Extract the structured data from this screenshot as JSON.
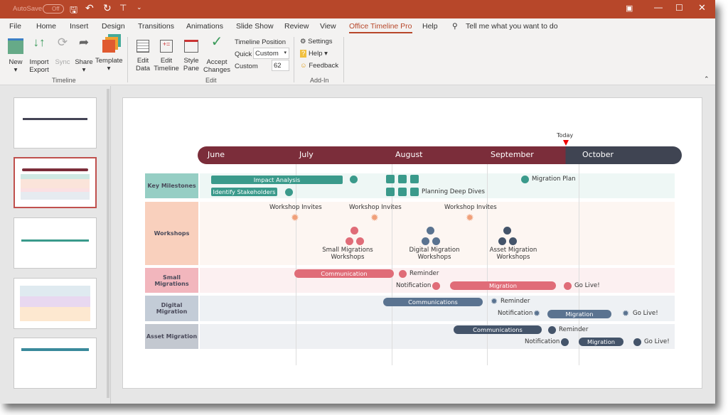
{
  "titlebar": {
    "autosave": "AutoSave",
    "autosave_state": "Off",
    "accent": "#b7472a"
  },
  "tabs": [
    "File",
    "Home",
    "Insert",
    "Design",
    "Transitions",
    "Animations",
    "Slide Show",
    "Review",
    "View",
    "Office Timeline Pro",
    "Help"
  ],
  "tell_me": "Tell me what you want to do",
  "ribbon": {
    "timeline_group": {
      "label": "Timeline",
      "buttons": [
        "New",
        "Import Export",
        "Sync",
        "Share",
        "Template"
      ]
    },
    "edit_group": {
      "label": "Edit",
      "buttons": [
        "Edit Data",
        "Edit Timeline",
        "Style Pane",
        "Accept Changes"
      ],
      "position_title": "Timeline Position",
      "quick_label": "Quick",
      "quick_value": "Custom",
      "custom_label": "Custom",
      "custom_value": "62"
    },
    "addin_group": {
      "label": "Add-In",
      "items": [
        "Settings",
        "Help",
        "Feedback"
      ]
    }
  },
  "slide": {
    "today": "Today",
    "months": [
      "June",
      "July",
      "August",
      "September",
      "October"
    ],
    "rows": [
      "Key Milestones",
      "Workshops",
      "Small Migrations",
      "Digital Migration",
      "Asset Migration"
    ],
    "key": {
      "impact": "Impact Analysis",
      "identify": "Identify Stakeholders",
      "plan": "Migration Plan",
      "deep": "Planning Deep Dives"
    },
    "workshops": {
      "invites": "Workshop Invites",
      "small": "Small Migrations Workshops",
      "digital": "Digital Migration Workshops",
      "asset": "Asset Migration Workshops"
    },
    "small": {
      "comm": "Communication",
      "reminder": "Reminder",
      "notification": "Notification",
      "migration": "Migration",
      "golive": "Go Live!"
    },
    "digital": {
      "comm": "Communications",
      "reminder": "Reminder",
      "notification": "Notification",
      "migration": "Migration",
      "golive": "Go Live!"
    },
    "asset": {
      "comm": "Communications",
      "reminder": "Reminder",
      "notification": "Notification",
      "migration": "Migration",
      "golive": "Go Live!"
    }
  },
  "colors": {
    "maroon": "#7b2d3a",
    "dark": "#3f4452",
    "teal": "#3a9a8b",
    "salmon": "#f0a07a",
    "pink": "#e06c78",
    "slate": "#5a7390",
    "navy": "#44546a"
  }
}
